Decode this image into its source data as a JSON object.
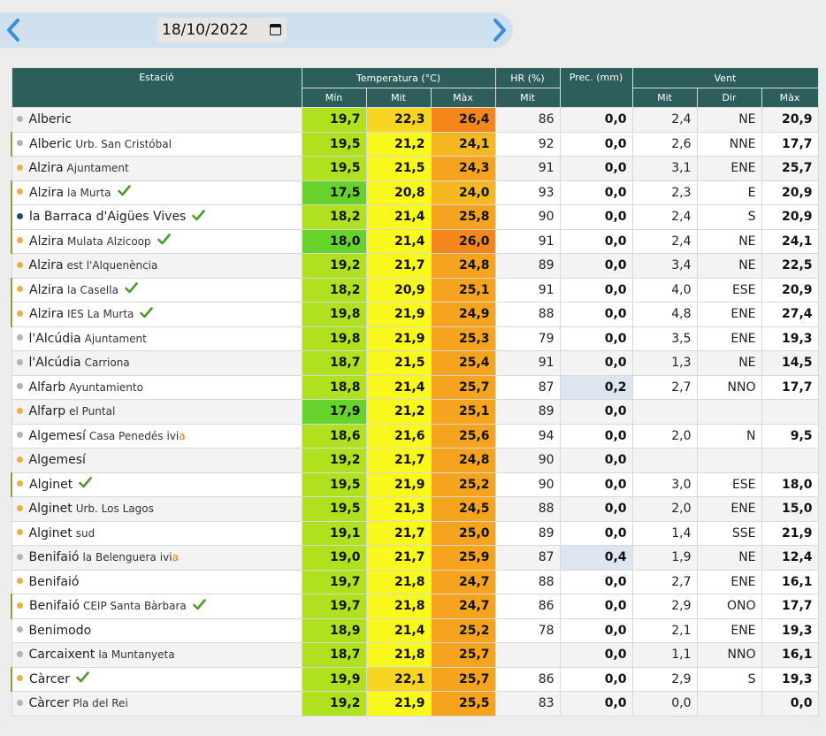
{
  "date": "18/10/2022",
  "columns": {
    "station": "Estació",
    "temperature": "Temperatura (°C)",
    "hr": "HR (%)",
    "prec": "Prec. (mm)",
    "wind": "Vent",
    "min": "Mín",
    "mit": "Mit",
    "max": "Màx",
    "hr_mit": "Mit",
    "wind_mit": "Mit",
    "wind_dir": "Dir",
    "wind_max": "Màx"
  },
  "colors": {
    "header": "#2e5e5b",
    "dot_gray": "#b3b3b3",
    "dot_yellow": "#e7b340",
    "dot_teal": "#14535a",
    "check_green": "#4d9a2a",
    "arrow_blue": "#3a8fd8"
  },
  "rows": [
    {
      "name": "Alberic",
      "sub": "",
      "dot": "gray",
      "check": false,
      "ivia": false,
      "hl": false,
      "min": "19,7",
      "mit": "22,3",
      "max": "26,4",
      "hr": "86",
      "prec": "0,0",
      "wmit": "2,4",
      "wdir": "NE",
      "wmax": "20,9"
    },
    {
      "name": "Alberic",
      "sub": "Urb. San Cristóbal",
      "dot": "gray",
      "check": false,
      "ivia": false,
      "hl": true,
      "min": "19,5",
      "mit": "21,2",
      "max": "24,1",
      "hr": "92",
      "prec": "0,0",
      "wmit": "2,6",
      "wdir": "NNE",
      "wmax": "17,7"
    },
    {
      "name": "Alzira",
      "sub": "Ajuntament",
      "dot": "yellow",
      "check": false,
      "ivia": false,
      "hl": false,
      "min": "19,5",
      "mit": "21,5",
      "max": "24,3",
      "hr": "91",
      "prec": "0,0",
      "wmit": "3,1",
      "wdir": "ENE",
      "wmax": "25,7"
    },
    {
      "name": "Alzira",
      "sub": "la Murta",
      "dot": "yellow",
      "check": true,
      "ivia": false,
      "hl": true,
      "min": "17,5",
      "mit": "20,8",
      "max": "24,0",
      "hr": "93",
      "prec": "0,0",
      "wmit": "2,3",
      "wdir": "E",
      "wmax": "20,9"
    },
    {
      "name": "la Barraca d'Aigües Vives",
      "sub": "",
      "dot": "teal",
      "check": true,
      "ivia": false,
      "hl": true,
      "min": "18,2",
      "mit": "21,4",
      "max": "25,8",
      "hr": "90",
      "prec": "0,0",
      "wmit": "2,4",
      "wdir": "S",
      "wmax": "20,9"
    },
    {
      "name": "Alzira",
      "sub": "Mulata Alzicoop",
      "dot": "yellow",
      "check": true,
      "ivia": false,
      "hl": true,
      "min": "18,0",
      "mit": "21,4",
      "max": "26,0",
      "hr": "91",
      "prec": "0,0",
      "wmit": "2,4",
      "wdir": "NE",
      "wmax": "24,1"
    },
    {
      "name": "Alzira",
      "sub": "est l'Alquenència",
      "dot": "yellow",
      "check": false,
      "ivia": false,
      "hl": false,
      "min": "19,2",
      "mit": "21,7",
      "max": "24,8",
      "hr": "89",
      "prec": "0,0",
      "wmit": "3,4",
      "wdir": "NE",
      "wmax": "22,5"
    },
    {
      "name": "Alzira",
      "sub": "la Casella",
      "dot": "yellow",
      "check": true,
      "ivia": false,
      "hl": true,
      "min": "18,2",
      "mit": "20,9",
      "max": "25,1",
      "hr": "91",
      "prec": "0,0",
      "wmit": "4,0",
      "wdir": "ESE",
      "wmax": "20,9"
    },
    {
      "name": "Alzira",
      "sub": "IES La Murta",
      "dot": "yellow",
      "check": true,
      "ivia": false,
      "hl": true,
      "min": "19,8",
      "mit": "21,9",
      "max": "24,9",
      "hr": "88",
      "prec": "0,0",
      "wmit": "4,8",
      "wdir": "ENE",
      "wmax": "27,4"
    },
    {
      "name": "l'Alcúdia",
      "sub": "Ajuntament",
      "dot": "gray",
      "check": false,
      "ivia": false,
      "hl": false,
      "min": "19,8",
      "mit": "21,9",
      "max": "25,3",
      "hr": "79",
      "prec": "0,0",
      "wmit": "3,5",
      "wdir": "ENE",
      "wmax": "19,3"
    },
    {
      "name": "l'Alcúdia",
      "sub": "Carriona",
      "dot": "gray",
      "check": false,
      "ivia": false,
      "hl": false,
      "min": "18,7",
      "mit": "21,5",
      "max": "25,4",
      "hr": "91",
      "prec": "0,0",
      "wmit": "1,3",
      "wdir": "NE",
      "wmax": "14,5"
    },
    {
      "name": "Alfarb",
      "sub": "Ayuntamiento",
      "dot": "gray",
      "check": false,
      "ivia": false,
      "hl": false,
      "min": "18,8",
      "mit": "21,4",
      "max": "25,7",
      "hr": "87",
      "prec": "0,2",
      "wmit": "2,7",
      "wdir": "NNO",
      "wmax": "17,7"
    },
    {
      "name": "Alfarp",
      "sub": "el Puntal",
      "dot": "yellow",
      "check": false,
      "ivia": false,
      "hl": false,
      "min": "17,9",
      "mit": "21,2",
      "max": "25,1",
      "hr": "89",
      "prec": "0,0",
      "wmit": "",
      "wdir": "",
      "wmax": ""
    },
    {
      "name": "Algemesí",
      "sub": "Casa Penedés",
      "dot": "gray",
      "check": false,
      "ivia": true,
      "hl": false,
      "min": "18,6",
      "mit": "21,6",
      "max": "25,6",
      "hr": "94",
      "prec": "0,0",
      "wmit": "2,0",
      "wdir": "N",
      "wmax": "9,5"
    },
    {
      "name": "Algemesí",
      "sub": "",
      "dot": "yellow",
      "check": false,
      "ivia": false,
      "hl": false,
      "min": "19,2",
      "mit": "21,7",
      "max": "24,8",
      "hr": "90",
      "prec": "0,0",
      "wmit": "",
      "wdir": "",
      "wmax": ""
    },
    {
      "name": "Alginet",
      "sub": "",
      "dot": "yellow",
      "check": true,
      "ivia": false,
      "hl": true,
      "min": "19,5",
      "mit": "21,9",
      "max": "25,2",
      "hr": "90",
      "prec": "0,0",
      "wmit": "3,0",
      "wdir": "ESE",
      "wmax": "18,0"
    },
    {
      "name": "Alginet",
      "sub": "Urb. Los Lagos",
      "dot": "yellow",
      "check": false,
      "ivia": false,
      "hl": false,
      "min": "19,5",
      "mit": "21,3",
      "max": "24,5",
      "hr": "88",
      "prec": "0,0",
      "wmit": "2,0",
      "wdir": "ENE",
      "wmax": "15,0"
    },
    {
      "name": "Alginet",
      "sub": "sud",
      "dot": "yellow",
      "check": false,
      "ivia": false,
      "hl": false,
      "min": "19,1",
      "mit": "21,7",
      "max": "25,0",
      "hr": "89",
      "prec": "0,0",
      "wmit": "1,4",
      "wdir": "SSE",
      "wmax": "21,9"
    },
    {
      "name": "Benifaió",
      "sub": "la Belenguera",
      "dot": "gray",
      "check": false,
      "ivia": true,
      "hl": false,
      "min": "19,0",
      "mit": "21,7",
      "max": "25,9",
      "hr": "87",
      "prec": "0,4",
      "wmit": "1,9",
      "wdir": "NE",
      "wmax": "12,4"
    },
    {
      "name": "Benifaió",
      "sub": "",
      "dot": "yellow",
      "check": false,
      "ivia": false,
      "hl": false,
      "min": "19,7",
      "mit": "21,8",
      "max": "24,7",
      "hr": "88",
      "prec": "0,0",
      "wmit": "2,7",
      "wdir": "ENE",
      "wmax": "16,1"
    },
    {
      "name": "Benifaió",
      "sub": "CEIP Santa Bàrbara",
      "dot": "yellow",
      "check": true,
      "ivia": false,
      "hl": true,
      "min": "19,7",
      "mit": "21,8",
      "max": "24,7",
      "hr": "86",
      "prec": "0,0",
      "wmit": "2,9",
      "wdir": "ONO",
      "wmax": "17,7"
    },
    {
      "name": "Benimodo",
      "sub": "",
      "dot": "gray",
      "check": false,
      "ivia": false,
      "hl": false,
      "min": "18,9",
      "mit": "21,4",
      "max": "25,2",
      "hr": "78",
      "prec": "0,0",
      "wmit": "2,1",
      "wdir": "ENE",
      "wmax": "19,3"
    },
    {
      "name": "Carcaixent",
      "sub": "la Muntanyeta",
      "dot": "gray",
      "check": false,
      "ivia": false,
      "hl": false,
      "min": "18,7",
      "mit": "21,8",
      "max": "25,7",
      "hr": "",
      "prec": "0,0",
      "wmit": "1,1",
      "wdir": "NNO",
      "wmax": "16,1"
    },
    {
      "name": "Càrcer",
      "sub": "",
      "dot": "yellow",
      "check": true,
      "ivia": false,
      "hl": true,
      "min": "19,9",
      "mit": "22,1",
      "max": "25,7",
      "hr": "86",
      "prec": "0,0",
      "wmit": "2,9",
      "wdir": "S",
      "wmax": "19,3"
    },
    {
      "name": "Càrcer",
      "sub": "Pla del Rei",
      "dot": "gray",
      "check": false,
      "ivia": false,
      "hl": false,
      "min": "19,2",
      "mit": "21,9",
      "max": "25,5",
      "hr": "83",
      "prec": "0,0",
      "wmit": "0,0",
      "wdir": "",
      "wmax": "0,0"
    }
  ]
}
